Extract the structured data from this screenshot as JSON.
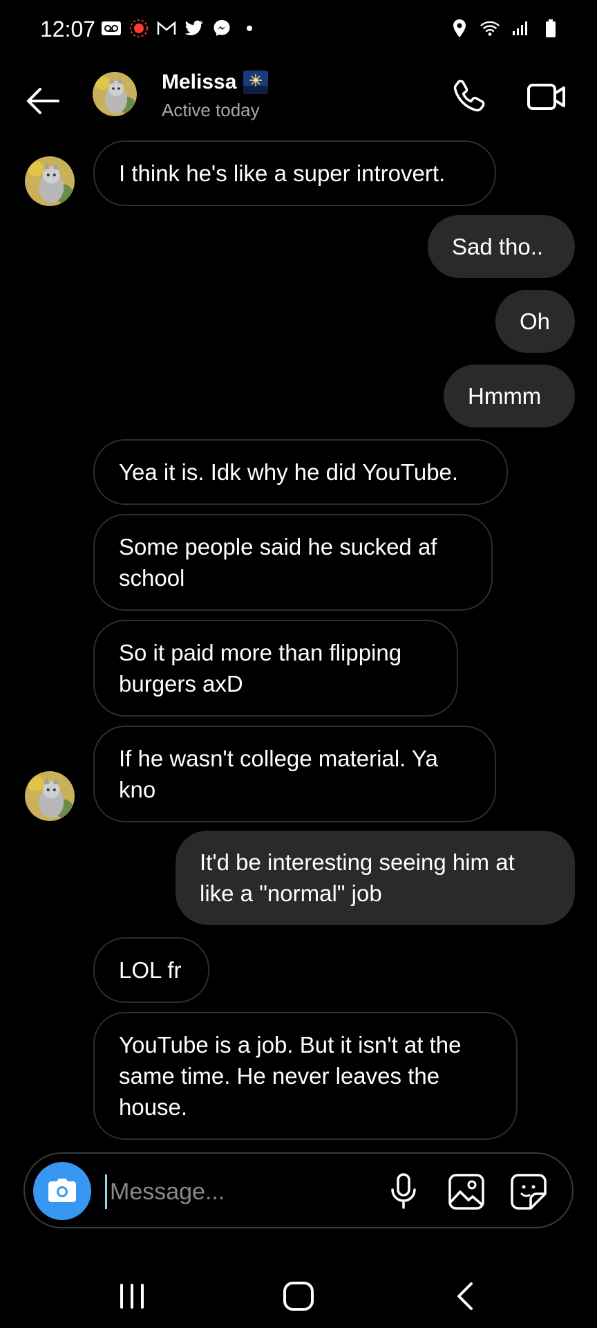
{
  "status_bar": {
    "time": "12:07",
    "left_icons": [
      "voicemail-icon",
      "screen-record-icon",
      "gmail-icon",
      "twitter-icon",
      "messenger-icon",
      "dot-icon"
    ],
    "right_icons": [
      "location-icon",
      "wifi-icon",
      "signal-icon",
      "battery-icon"
    ]
  },
  "header": {
    "contact_name": "Melissa",
    "status": "Active today"
  },
  "messages": [
    {
      "direction": "in",
      "text": "I think he's like a super introvert."
    },
    {
      "direction": "out",
      "text": "Sad tho.."
    },
    {
      "direction": "out",
      "text": "Oh"
    },
    {
      "direction": "out",
      "text": "Hmmm"
    },
    {
      "direction": "in",
      "text": "Yea it is. Idk why he did YouTube."
    },
    {
      "direction": "in",
      "text": "Some people said he sucked af school"
    },
    {
      "direction": "in",
      "text": "So it paid more than flipping burgers axD"
    },
    {
      "direction": "in",
      "text": "If he wasn't college material. Ya kno"
    },
    {
      "direction": "out",
      "text": "It'd be interesting seeing him at like a \"normal\" job"
    },
    {
      "direction": "in",
      "text": "LOL fr"
    },
    {
      "direction": "in",
      "text": "YouTube is a job. But it isn't at the same time. He never leaves the house."
    }
  ],
  "composer": {
    "placeholder": "Message..."
  },
  "colors": {
    "background": "#000000",
    "outgoing_bubble": "#2a2a2a",
    "incoming_border": "#2e2e2e",
    "camera_button": "#3897f0",
    "secondary_text": "#a8a8a8"
  }
}
